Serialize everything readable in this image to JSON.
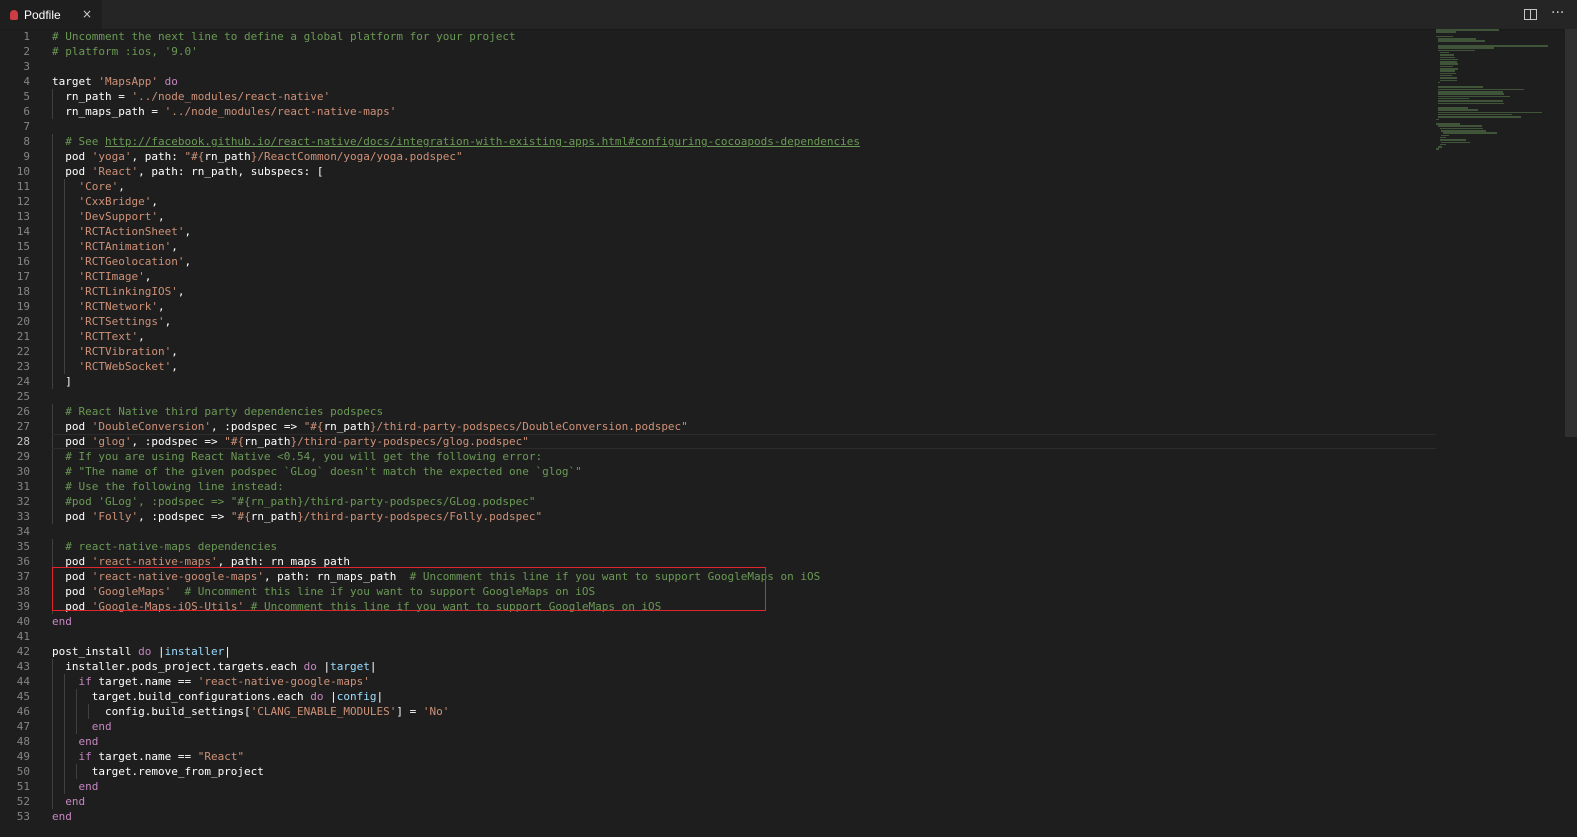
{
  "tab": {
    "label": "Podfile",
    "close": "×"
  },
  "actions": {
    "split_icon": "split-editor-icon",
    "more": "···"
  },
  "current_line": 28,
  "lines": [
    [
      [
        "c",
        "# Uncomment the next line to define a global platform for your project"
      ]
    ],
    [
      [
        "c",
        "# platform :ios, '9.0'"
      ]
    ],
    [],
    [
      [
        "w",
        "target "
      ],
      [
        "s",
        "'MapsApp'"
      ],
      [
        "k",
        " do"
      ]
    ],
    [
      [
        "w",
        "  rn_path = "
      ],
      [
        "s",
        "'../node_modules/react-native'"
      ]
    ],
    [
      [
        "w",
        "  rn_maps_path = "
      ],
      [
        "s",
        "'../node_modules/react-native-maps'"
      ]
    ],
    [],
    [
      [
        "c",
        "  # See "
      ],
      [
        "u",
        "http://facebook.github.io/react-native/docs/integration-with-existing-apps.html#configuring-cocoapods-dependencies"
      ]
    ],
    [
      [
        "w",
        "  pod "
      ],
      [
        "s",
        "'yoga'"
      ],
      [
        "w",
        ", path: "
      ],
      [
        "s",
        "\"#{"
      ],
      [
        "w",
        "rn_path"
      ],
      [
        "s",
        "}/ReactCommon/yoga/yoga.podspec\""
      ]
    ],
    [
      [
        "w",
        "  pod "
      ],
      [
        "s",
        "'React'"
      ],
      [
        "w",
        ", path: rn_path, subspecs: ["
      ]
    ],
    [
      [
        "s",
        "    'Core'"
      ],
      [
        "w",
        ","
      ]
    ],
    [
      [
        "s",
        "    'CxxBridge'"
      ],
      [
        "w",
        ","
      ]
    ],
    [
      [
        "s",
        "    'DevSupport'"
      ],
      [
        "w",
        ","
      ]
    ],
    [
      [
        "s",
        "    'RCTActionSheet'"
      ],
      [
        "w",
        ","
      ]
    ],
    [
      [
        "s",
        "    'RCTAnimation'"
      ],
      [
        "w",
        ","
      ]
    ],
    [
      [
        "s",
        "    'RCTGeolocation'"
      ],
      [
        "w",
        ","
      ]
    ],
    [
      [
        "s",
        "    'RCTImage'"
      ],
      [
        "w",
        ","
      ]
    ],
    [
      [
        "s",
        "    'RCTLinkingIOS'"
      ],
      [
        "w",
        ","
      ]
    ],
    [
      [
        "s",
        "    'RCTNetwork'"
      ],
      [
        "w",
        ","
      ]
    ],
    [
      [
        "s",
        "    'RCTSettings'"
      ],
      [
        "w",
        ","
      ]
    ],
    [
      [
        "s",
        "    'RCTText'"
      ],
      [
        "w",
        ","
      ]
    ],
    [
      [
        "s",
        "    'RCTVibration'"
      ],
      [
        "w",
        ","
      ]
    ],
    [
      [
        "s",
        "    'RCTWebSocket'"
      ],
      [
        "w",
        ","
      ]
    ],
    [
      [
        "w",
        "  ]"
      ]
    ],
    [],
    [
      [
        "c",
        "  # React Native third party dependencies podspecs"
      ]
    ],
    [
      [
        "w",
        "  pod "
      ],
      [
        "s",
        "'DoubleConversion'"
      ],
      [
        "w",
        ", :podspec => "
      ],
      [
        "s",
        "\"#{"
      ],
      [
        "w",
        "rn_path"
      ],
      [
        "s",
        "}/third-party-podspecs/DoubleConversion.podspec\""
      ]
    ],
    [
      [
        "w",
        "  pod "
      ],
      [
        "s",
        "'glog'"
      ],
      [
        "w",
        ", :podspec => "
      ],
      [
        "s",
        "\"#{"
      ],
      [
        "w",
        "rn_path"
      ],
      [
        "s",
        "}/third-party-podspecs/glog.podspec\""
      ]
    ],
    [
      [
        "c",
        "  # If you are using React Native <0.54, you will get the following error:"
      ]
    ],
    [
      [
        "c",
        "  # \"The name of the given podspec `GLog` doesn't match the expected one `glog`\""
      ]
    ],
    [
      [
        "c",
        "  # Use the following line instead:"
      ]
    ],
    [
      [
        "c",
        "  #pod 'GLog', :podspec => \"#{rn_path}/third-party-podspecs/GLog.podspec\""
      ]
    ],
    [
      [
        "w",
        "  pod "
      ],
      [
        "s",
        "'Folly'"
      ],
      [
        "w",
        ", :podspec => "
      ],
      [
        "s",
        "\"#{"
      ],
      [
        "w",
        "rn_path"
      ],
      [
        "s",
        "}/third-party-podspecs/Folly.podspec\""
      ]
    ],
    [],
    [
      [
        "c",
        "  # react-native-maps dependencies"
      ]
    ],
    [
      [
        "w",
        "  pod "
      ],
      [
        "s",
        "'react-native-maps'"
      ],
      [
        "w",
        ", path: rn_maps_path"
      ]
    ],
    [
      [
        "w",
        "  pod "
      ],
      [
        "s",
        "'react-native-google-maps'"
      ],
      [
        "w",
        ", path: rn_maps_path  "
      ],
      [
        "c",
        "# Uncomment this line if you want to support GoogleMaps on iOS"
      ]
    ],
    [
      [
        "w",
        "  pod "
      ],
      [
        "s",
        "'GoogleMaps'"
      ],
      [
        "w",
        "  "
      ],
      [
        "c",
        "# Uncomment this line if you want to support GoogleMaps on iOS"
      ]
    ],
    [
      [
        "w",
        "  pod "
      ],
      [
        "s",
        "'Google-Maps-iOS-Utils'"
      ],
      [
        "w",
        " "
      ],
      [
        "c",
        "# Uncomment this line if you want to support GoogleMaps on iOS"
      ]
    ],
    [
      [
        "k",
        "end"
      ]
    ],
    [],
    [
      [
        "w",
        "post_install "
      ],
      [
        "k",
        "do"
      ],
      [
        "w",
        " |"
      ],
      [
        "v",
        "installer"
      ],
      [
        "w",
        "|"
      ]
    ],
    [
      [
        "w",
        "  installer.pods_project.targets.each "
      ],
      [
        "k",
        "do"
      ],
      [
        "w",
        " |"
      ],
      [
        "v",
        "target"
      ],
      [
        "w",
        "|"
      ]
    ],
    [
      [
        "k",
        "    if"
      ],
      [
        "w",
        " target.name == "
      ],
      [
        "s",
        "'react-native-google-maps'"
      ]
    ],
    [
      [
        "w",
        "      target.build_configurations.each "
      ],
      [
        "k",
        "do"
      ],
      [
        "w",
        " |"
      ],
      [
        "v",
        "config"
      ],
      [
        "w",
        "|"
      ]
    ],
    [
      [
        "w",
        "        config.build_settings["
      ],
      [
        "s",
        "'CLANG_ENABLE_MODULES'"
      ],
      [
        "w",
        "] = "
      ],
      [
        "s",
        "'No'"
      ]
    ],
    [
      [
        "k",
        "      end"
      ]
    ],
    [
      [
        "k",
        "    end"
      ]
    ],
    [
      [
        "k",
        "    if"
      ],
      [
        "w",
        " target.name == "
      ],
      [
        "s",
        "\"React\""
      ]
    ],
    [
      [
        "w",
        "      target.remove_from_project"
      ]
    ],
    [
      [
        "k",
        "    end"
      ]
    ],
    [
      [
        "k",
        "  end"
      ]
    ],
    [
      [
        "k",
        "end"
      ]
    ]
  ]
}
